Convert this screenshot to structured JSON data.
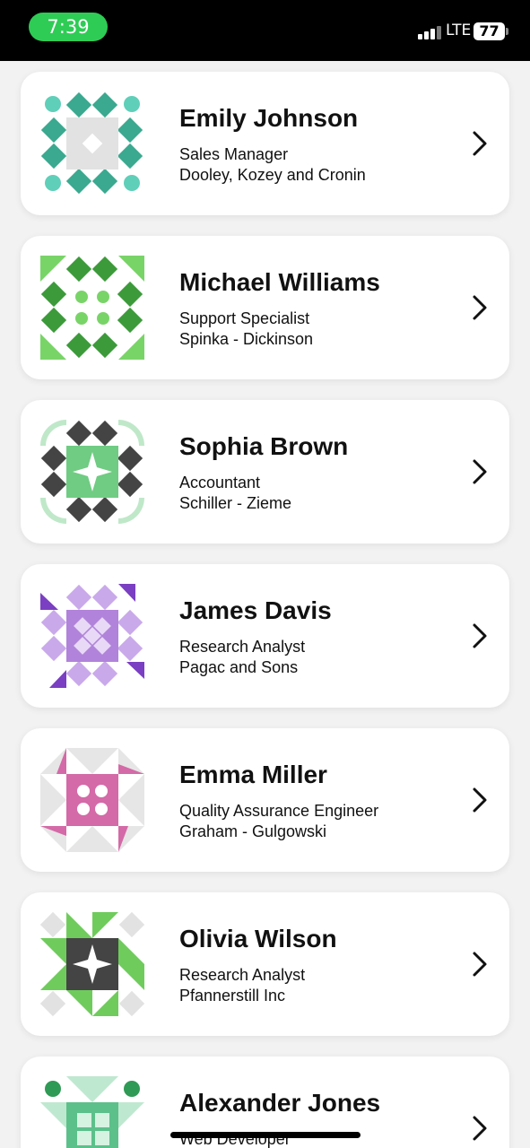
{
  "status_bar": {
    "time": "7:39",
    "network": "LTE",
    "battery": "77"
  },
  "contacts": [
    {
      "name": "Emily Johnson",
      "role": "Sales Manager",
      "company": "Dooley, Kozey and Cronin",
      "color": "#3aa98f",
      "light": "#5fcfb9"
    },
    {
      "name": "Michael Williams",
      "role": "Support Specialist",
      "company": "Spinka - Dickinson",
      "color": "#3c9a3a",
      "light": "#79d468"
    },
    {
      "name": "Sophia Brown",
      "role": "Accountant",
      "company": "Schiller - Zieme",
      "color": "#444444",
      "light": "#6fcc82"
    },
    {
      "name": "James Davis",
      "role": "Research Analyst",
      "company": "Pagac and Sons",
      "color": "#7a3fc2",
      "light": "#c9a9ea"
    },
    {
      "name": "Emma Miller",
      "role": "Quality Assurance Engineer",
      "company": "Graham - Gulgowski",
      "color": "#d46aa7",
      "light": "#e6e6e6"
    },
    {
      "name": "Olivia Wilson",
      "role": "Research Analyst",
      "company": "Pfannerstill Inc",
      "color": "#444444",
      "light": "#6fcc5c"
    },
    {
      "name": "Alexander Jones",
      "role": "Web Developer",
      "company": "",
      "color": "#5cc08b",
      "light": "#bfe8d0"
    }
  ]
}
